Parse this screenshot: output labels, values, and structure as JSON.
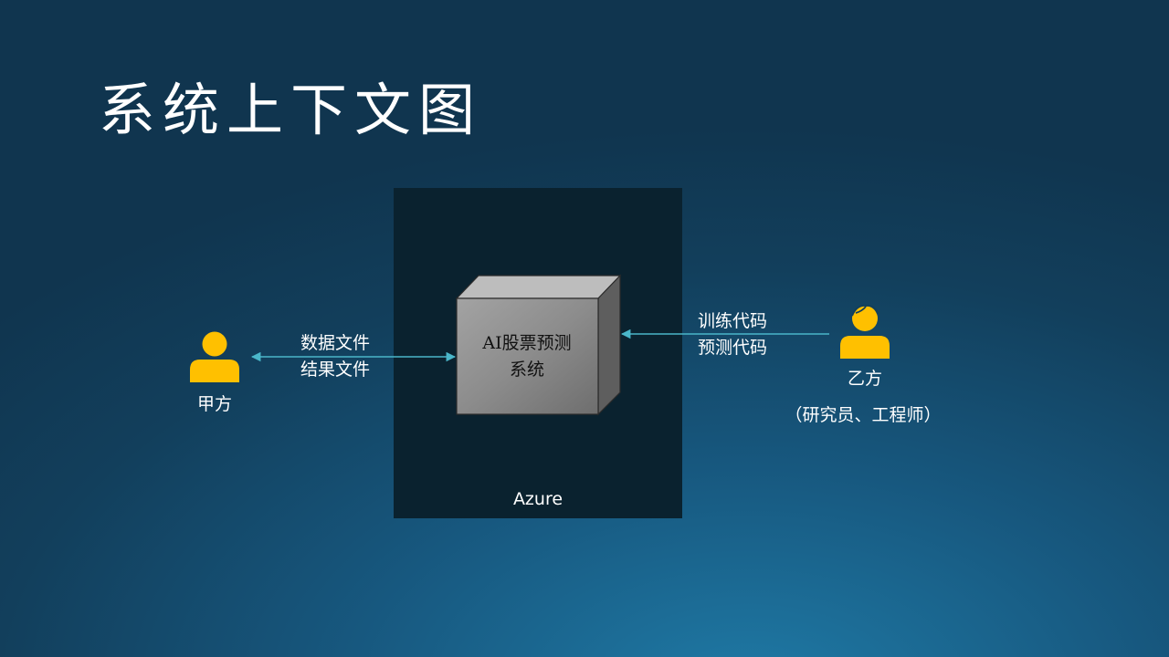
{
  "slide": {
    "title": "系统上下文图"
  },
  "azure": {
    "label": "Azure"
  },
  "system": {
    "line1": "AI股票预测",
    "line2": "系统"
  },
  "party_a": {
    "name": "甲方",
    "flow_line1": "数据文件",
    "flow_line2": "结果文件"
  },
  "party_b": {
    "name": "乙方",
    "role": "（研究员、工程师）",
    "flow_line1": "训练代码",
    "flow_line2": "预测代码"
  },
  "colors": {
    "actor": "#ffc000",
    "arrow": "#4ab6c9",
    "cube_front": "#8a8a8a",
    "azure_bg": "#0a222f"
  },
  "icons": {
    "party_a": "person-icon",
    "party_b": "person-with-hair-icon"
  }
}
